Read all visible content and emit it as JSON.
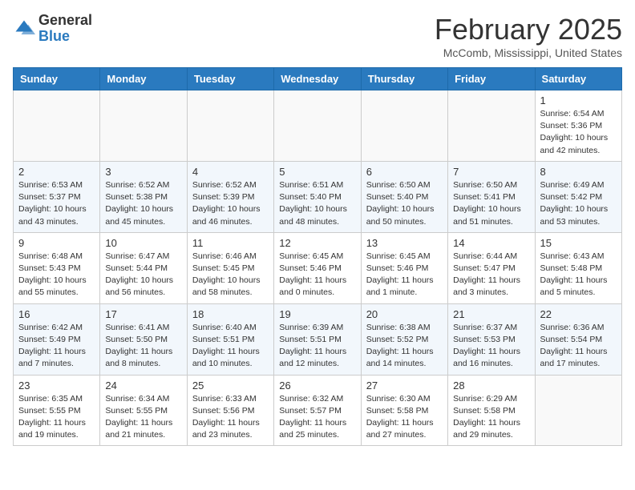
{
  "header": {
    "logo_general": "General",
    "logo_blue": "Blue",
    "month_title": "February 2025",
    "location": "McComb, Mississippi, United States"
  },
  "weekdays": [
    "Sunday",
    "Monday",
    "Tuesday",
    "Wednesday",
    "Thursday",
    "Friday",
    "Saturday"
  ],
  "weeks": [
    [
      {
        "day": "",
        "info": ""
      },
      {
        "day": "",
        "info": ""
      },
      {
        "day": "",
        "info": ""
      },
      {
        "day": "",
        "info": ""
      },
      {
        "day": "",
        "info": ""
      },
      {
        "day": "",
        "info": ""
      },
      {
        "day": "1",
        "info": "Sunrise: 6:54 AM\nSunset: 5:36 PM\nDaylight: 10 hours and 42 minutes."
      }
    ],
    [
      {
        "day": "2",
        "info": "Sunrise: 6:53 AM\nSunset: 5:37 PM\nDaylight: 10 hours and 43 minutes."
      },
      {
        "day": "3",
        "info": "Sunrise: 6:52 AM\nSunset: 5:38 PM\nDaylight: 10 hours and 45 minutes."
      },
      {
        "day": "4",
        "info": "Sunrise: 6:52 AM\nSunset: 5:39 PM\nDaylight: 10 hours and 46 minutes."
      },
      {
        "day": "5",
        "info": "Sunrise: 6:51 AM\nSunset: 5:40 PM\nDaylight: 10 hours and 48 minutes."
      },
      {
        "day": "6",
        "info": "Sunrise: 6:50 AM\nSunset: 5:40 PM\nDaylight: 10 hours and 50 minutes."
      },
      {
        "day": "7",
        "info": "Sunrise: 6:50 AM\nSunset: 5:41 PM\nDaylight: 10 hours and 51 minutes."
      },
      {
        "day": "8",
        "info": "Sunrise: 6:49 AM\nSunset: 5:42 PM\nDaylight: 10 hours and 53 minutes."
      }
    ],
    [
      {
        "day": "9",
        "info": "Sunrise: 6:48 AM\nSunset: 5:43 PM\nDaylight: 10 hours and 55 minutes."
      },
      {
        "day": "10",
        "info": "Sunrise: 6:47 AM\nSunset: 5:44 PM\nDaylight: 10 hours and 56 minutes."
      },
      {
        "day": "11",
        "info": "Sunrise: 6:46 AM\nSunset: 5:45 PM\nDaylight: 10 hours and 58 minutes."
      },
      {
        "day": "12",
        "info": "Sunrise: 6:45 AM\nSunset: 5:46 PM\nDaylight: 11 hours and 0 minutes."
      },
      {
        "day": "13",
        "info": "Sunrise: 6:45 AM\nSunset: 5:46 PM\nDaylight: 11 hours and 1 minute."
      },
      {
        "day": "14",
        "info": "Sunrise: 6:44 AM\nSunset: 5:47 PM\nDaylight: 11 hours and 3 minutes."
      },
      {
        "day": "15",
        "info": "Sunrise: 6:43 AM\nSunset: 5:48 PM\nDaylight: 11 hours and 5 minutes."
      }
    ],
    [
      {
        "day": "16",
        "info": "Sunrise: 6:42 AM\nSunset: 5:49 PM\nDaylight: 11 hours and 7 minutes."
      },
      {
        "day": "17",
        "info": "Sunrise: 6:41 AM\nSunset: 5:50 PM\nDaylight: 11 hours and 8 minutes."
      },
      {
        "day": "18",
        "info": "Sunrise: 6:40 AM\nSunset: 5:51 PM\nDaylight: 11 hours and 10 minutes."
      },
      {
        "day": "19",
        "info": "Sunrise: 6:39 AM\nSunset: 5:51 PM\nDaylight: 11 hours and 12 minutes."
      },
      {
        "day": "20",
        "info": "Sunrise: 6:38 AM\nSunset: 5:52 PM\nDaylight: 11 hours and 14 minutes."
      },
      {
        "day": "21",
        "info": "Sunrise: 6:37 AM\nSunset: 5:53 PM\nDaylight: 11 hours and 16 minutes."
      },
      {
        "day": "22",
        "info": "Sunrise: 6:36 AM\nSunset: 5:54 PM\nDaylight: 11 hours and 17 minutes."
      }
    ],
    [
      {
        "day": "23",
        "info": "Sunrise: 6:35 AM\nSunset: 5:55 PM\nDaylight: 11 hours and 19 minutes."
      },
      {
        "day": "24",
        "info": "Sunrise: 6:34 AM\nSunset: 5:55 PM\nDaylight: 11 hours and 21 minutes."
      },
      {
        "day": "25",
        "info": "Sunrise: 6:33 AM\nSunset: 5:56 PM\nDaylight: 11 hours and 23 minutes."
      },
      {
        "day": "26",
        "info": "Sunrise: 6:32 AM\nSunset: 5:57 PM\nDaylight: 11 hours and 25 minutes."
      },
      {
        "day": "27",
        "info": "Sunrise: 6:30 AM\nSunset: 5:58 PM\nDaylight: 11 hours and 27 minutes."
      },
      {
        "day": "28",
        "info": "Sunrise: 6:29 AM\nSunset: 5:58 PM\nDaylight: 11 hours and 29 minutes."
      },
      {
        "day": "",
        "info": ""
      }
    ]
  ]
}
